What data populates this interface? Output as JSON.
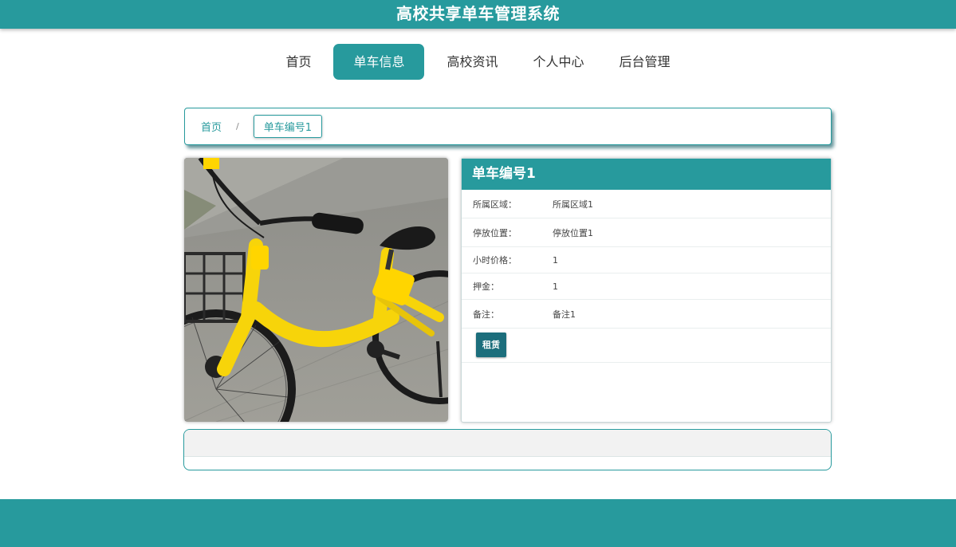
{
  "header": {
    "title": "高校共享单车管理系统"
  },
  "nav": {
    "items": [
      {
        "label": "首页"
      },
      {
        "label": "单车信息"
      },
      {
        "label": "高校资讯"
      },
      {
        "label": "个人中心"
      },
      {
        "label": "后台管理"
      }
    ],
    "active": "单车信息"
  },
  "breadcrumb": {
    "home": "首页",
    "separator": "/",
    "current": "单车编号1"
  },
  "detail": {
    "title": "单车编号1",
    "fields": [
      {
        "label": "所属区域：",
        "value": "所属区域1"
      },
      {
        "label": "停放位置：",
        "value": "停放位置1"
      },
      {
        "label": "小时价格：",
        "value": "1"
      },
      {
        "label": "押金：",
        "value": "1"
      },
      {
        "label": "备注：",
        "value": "备注1"
      }
    ],
    "rent_button": "租赁"
  },
  "colors": {
    "primary": "#279a9d",
    "button": "#1c6e7c",
    "bike": "#ffd500"
  },
  "image": {
    "subject": "yellow-shared-bicycle-photo"
  }
}
